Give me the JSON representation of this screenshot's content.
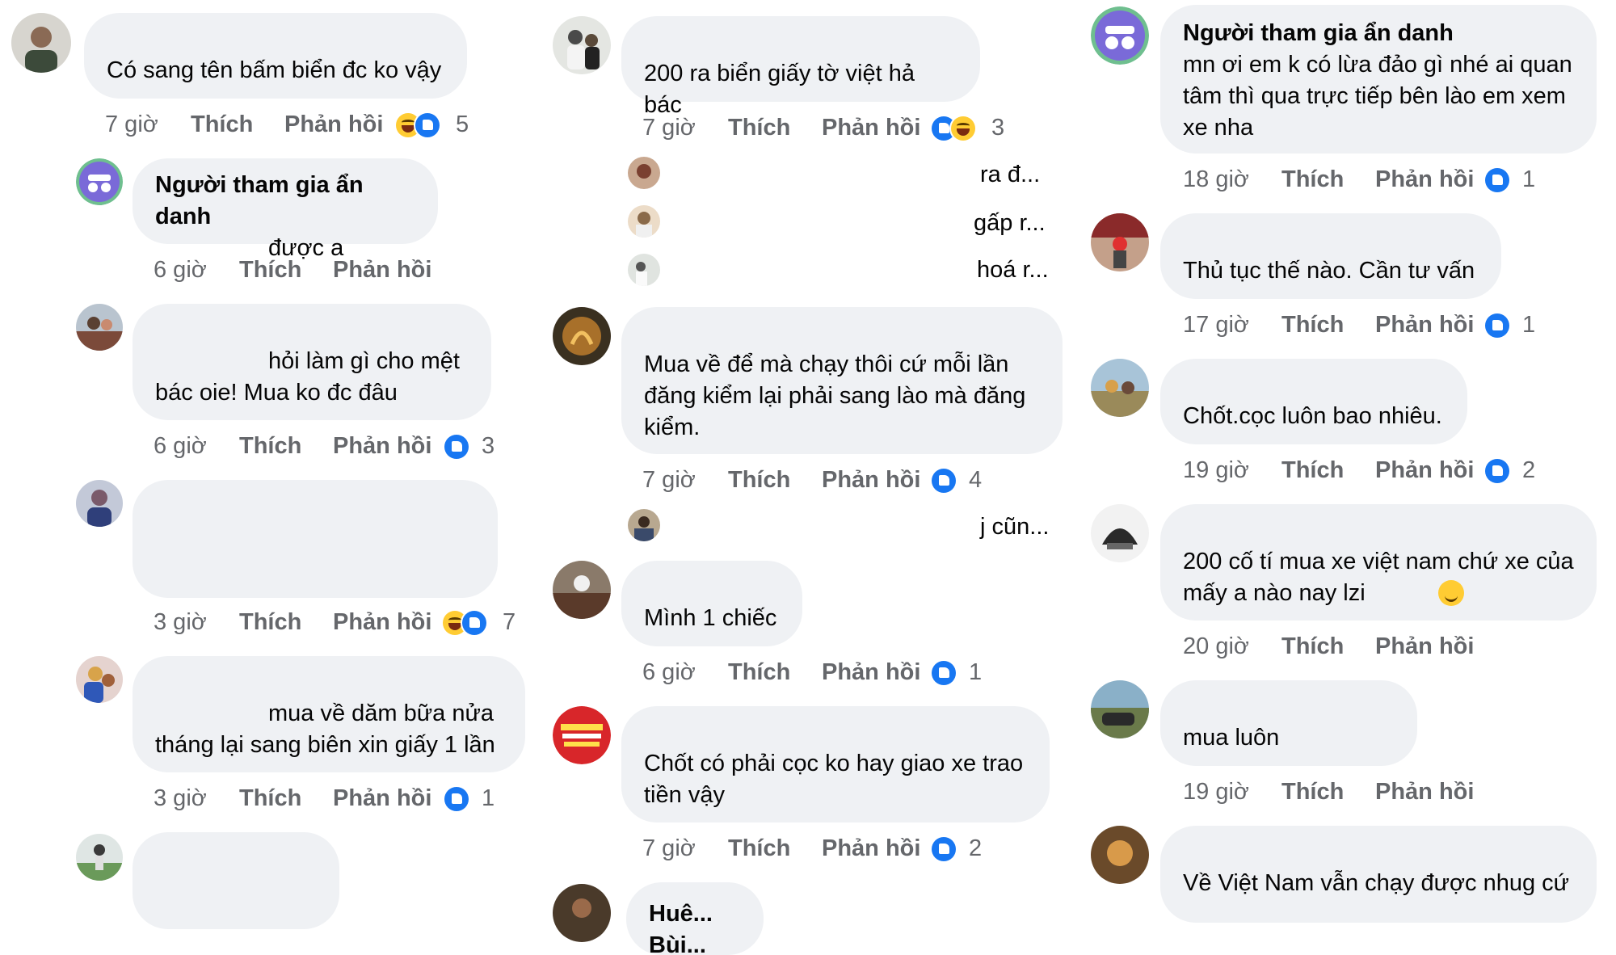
{
  "col1": {
    "c1": {
      "text": "Có sang tên bấm biển đc ko vậy",
      "time": "7 giờ",
      "like": "Thích",
      "reply": "Phản hồi",
      "count": "5"
    },
    "c2": {
      "author": "Người tham gia ẩn danh",
      "text": "được a",
      "time": "6 giờ",
      "like": "Thích",
      "reply": "Phản hồi"
    },
    "c3": {
      "text": "hỏi làm gì cho mệt\nbác oie! Mua ko đc đâu",
      "time": "6 giờ",
      "like": "Thích",
      "reply": "Phản hồi",
      "count": "3"
    },
    "c4": {
      "time": "3 giờ",
      "like": "Thích",
      "reply": "Phản hồi",
      "count": "7"
    },
    "c5": {
      "text": "mua về dăm bữa nửa\ntháng lại sang biên xin giấy 1 lần",
      "time": "3 giờ",
      "like": "Thích",
      "reply": "Phản hồi",
      "count": "1"
    }
  },
  "col2": {
    "c1": {
      "text": "200 ra biển giấy tờ việt hả bác",
      "time": "7 giờ",
      "like": "Thích",
      "reply": "Phản hồi",
      "count": "3"
    },
    "r1": "ra đ...",
    "r2": "gấp r...",
    "r3": "hoá r...",
    "c2": {
      "text": "Mua về để mà chạy thôi cứ mỗi lần\nđăng kiểm lại phải sang lào mà đăng\nkiểm.",
      "time": "7 giờ",
      "like": "Thích",
      "reply": "Phản hồi",
      "count": "4"
    },
    "r4": "j cũn...",
    "c3": {
      "text": "Mình 1 chiếc",
      "time": "6 giờ",
      "like": "Thích",
      "reply": "Phản hồi",
      "count": "1"
    },
    "c4": {
      "text": "Chốt có phải cọc ko hay giao xe trao\ntiền vậy",
      "time": "7 giờ",
      "like": "Thích",
      "reply": "Phản hồi",
      "count": "2"
    },
    "c5": {
      "text": "Huê... Bùi..."
    }
  },
  "col3": {
    "c1": {
      "author": "Người tham gia ẩn danh",
      "text": "mn ơi em k có lừa đảo gì nhé ai quan\ntâm thì qua trực tiếp bên lào em xem\nxe nha",
      "time": "18 giờ",
      "like": "Thích",
      "reply": "Phản hồi",
      "count": "1"
    },
    "c2": {
      "text": "Thủ tục thế nào. Cần tư vấn",
      "time": "17 giờ",
      "like": "Thích",
      "reply": "Phản hồi",
      "count": "1"
    },
    "c3": {
      "text": "Chốt.cọc luôn bao nhiêu.",
      "time": "19 giờ",
      "like": "Thích",
      "reply": "Phản hồi",
      "count": "2"
    },
    "c4": {
      "text": "200 cố tí mua xe việt nam chứ xe của\nmấy a nào nay lzi",
      "time": "20 giờ",
      "like": "Thích",
      "reply": "Phản hồi"
    },
    "c5": {
      "text": "mua luôn",
      "time": "19 giờ",
      "like": "Thích",
      "reply": "Phản hồi"
    },
    "c6": {
      "text": "Về Việt Nam vẫn chạy được nhug cứ"
    }
  },
  "colors": {
    "bubble": "#eff1f4",
    "meta": "#65676b",
    "like_blue": "#1877f2",
    "haha_yellow": "#ffcc33"
  },
  "icons": [
    "like-reaction-icon",
    "haha-reaction-icon",
    "anonymous-icon",
    "smile-emoji-icon"
  ]
}
